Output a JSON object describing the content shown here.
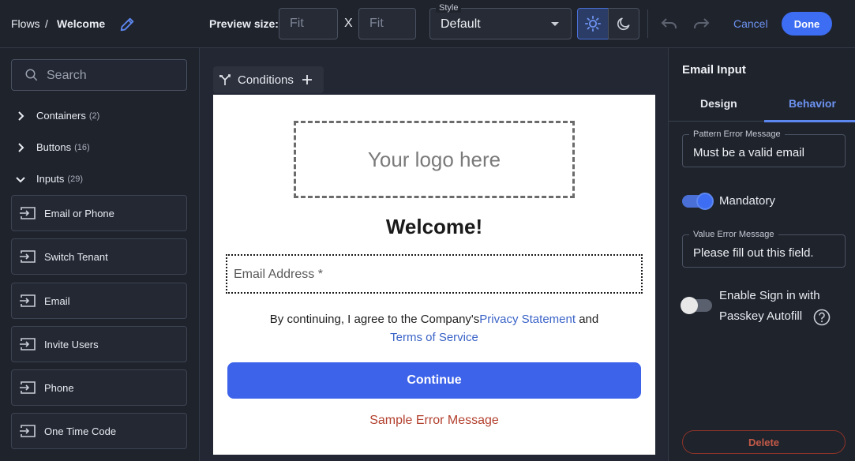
{
  "header": {
    "breadcrumb": [
      "Flows",
      "/",
      "Welcome"
    ],
    "preview_size_label": "Preview size:",
    "width_placeholder": "Fit",
    "height_placeholder": "Fit",
    "size_separator": "X",
    "style_label": "Style",
    "style_value": "Default",
    "cancel_label": "Cancel",
    "done_label": "Done"
  },
  "sidebar": {
    "search_placeholder": "Search",
    "groups": [
      {
        "label": "Containers",
        "count": "(2)",
        "expanded": false
      },
      {
        "label": "Buttons",
        "count": "(16)",
        "expanded": false
      },
      {
        "label": "Inputs",
        "count": "(29)",
        "expanded": true
      }
    ],
    "items": [
      "Email or Phone",
      "Switch Tenant",
      "Email",
      "Invite Users",
      "Phone",
      "One Time Code"
    ]
  },
  "canvas": {
    "conditions_label": "Conditions",
    "logo_placeholder": "Your logo here",
    "heading": "Welcome!",
    "email_placeholder": "Email Address *",
    "terms_prefix": "By continuing, I agree to the Company's",
    "privacy_link": "Privacy Statement",
    "terms_and": "and",
    "terms_link": "Terms of Service",
    "continue_label": "Continue",
    "error_message": "Sample Error Message"
  },
  "panel": {
    "title": "Email Input",
    "tabs": [
      "Design",
      "Behavior"
    ],
    "active_tab": "Behavior",
    "pattern_error_label": "Pattern Error Message",
    "pattern_error_value": "Must be a valid email",
    "mandatory_label": "Mandatory",
    "mandatory_on": true,
    "value_error_label": "Value Error Message",
    "value_error_value": "Please fill out this field.",
    "passkey_label_line1": "Enable Sign in with",
    "passkey_label_line2": "Passkey Autofill",
    "passkey_on": false,
    "delete_label": "Delete"
  },
  "colors": {
    "accent": "#3d6df2",
    "link": "#6d93f1",
    "error": "#b3402e",
    "danger": "#c45a48"
  }
}
